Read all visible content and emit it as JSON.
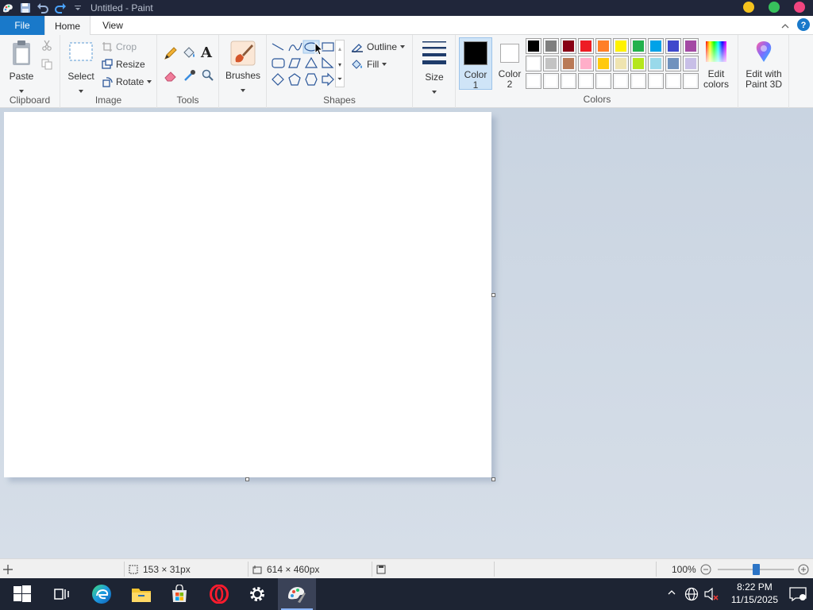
{
  "titlebar": {
    "title": "Untitled - Paint"
  },
  "tabs": {
    "file": "File",
    "home": "Home",
    "view": "View"
  },
  "ribbon": {
    "clipboard": {
      "label": "Clipboard",
      "paste": "Paste"
    },
    "image": {
      "label": "Image",
      "select": "Select",
      "crop": "Crop",
      "resize": "Resize",
      "rotate": "Rotate"
    },
    "tools": {
      "label": "Tools"
    },
    "brushes": {
      "label": "Brushes"
    },
    "shapes": {
      "label": "Shapes",
      "outline": "Outline",
      "fill": "Fill"
    },
    "size": {
      "label": "Size"
    },
    "colors": {
      "label": "Colors",
      "color1_line1": "Color",
      "color1_line2": "1",
      "color2_line1": "Color",
      "color2_line2": "2",
      "edit_colors_line1": "Edit",
      "edit_colors_line2": "colors",
      "paint3d_line1": "Edit with",
      "paint3d_line2": "Paint 3D",
      "color1": "#000000",
      "color2": "#ffffff",
      "palette_row1": [
        "#000000",
        "#7f7f7f",
        "#880015",
        "#ed1c24",
        "#ff7f27",
        "#fff200",
        "#22b14c",
        "#00a2e8",
        "#3f48cc",
        "#a349a4"
      ],
      "palette_row2": [
        "#ffffff",
        "#c3c3c3",
        "#b97a57",
        "#ffaec9",
        "#ffc90e",
        "#efe4b0",
        "#b5e61d",
        "#99d9ea",
        "#7092be",
        "#c8bfe7"
      ]
    }
  },
  "status": {
    "selection_size": "153 × 31px",
    "canvas_size": "614 × 460px",
    "zoom": "100%",
    "zoom_level": 0.5
  },
  "taskbar": {
    "time": "8:22 PM",
    "date": "11/15/2025"
  },
  "icons": {
    "save": "save-icon",
    "undo": "undo-icon",
    "redo": "redo-icon",
    "help": "help-icon",
    "start": "windows-start-icon"
  }
}
